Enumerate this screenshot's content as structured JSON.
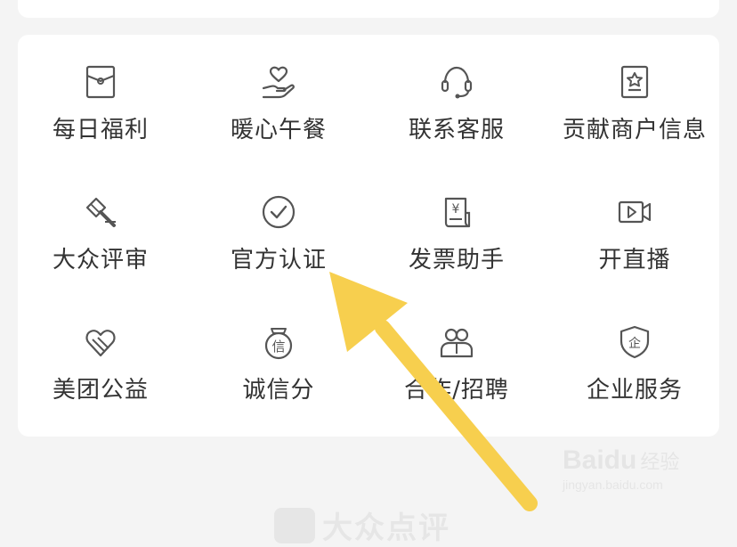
{
  "grid": {
    "items": [
      {
        "label": "每日福利",
        "icon": "envelope-icon"
      },
      {
        "label": "暖心午餐",
        "icon": "heart-hand-icon"
      },
      {
        "label": "联系客服",
        "icon": "headset-icon"
      },
      {
        "label": "贡献商户信息",
        "icon": "star-document-icon"
      },
      {
        "label": "大众评审",
        "icon": "gavel-icon"
      },
      {
        "label": "官方认证",
        "icon": "check-circle-icon"
      },
      {
        "label": "发票助手",
        "icon": "invoice-icon"
      },
      {
        "label": "开直播",
        "icon": "video-camera-icon"
      },
      {
        "label": "美团公益",
        "icon": "charity-heart-icon"
      },
      {
        "label": "诚信分",
        "icon": "credit-badge-icon"
      },
      {
        "label": "合作/招聘",
        "icon": "people-icon"
      },
      {
        "label": "企业服务",
        "icon": "shield-enterprise-icon"
      }
    ]
  },
  "icon_glyphs": {
    "invoice": "¥",
    "credit": "信",
    "enterprise": "企"
  },
  "footer": {
    "text": "大众点评"
  },
  "watermark": {
    "brand": "Baidu",
    "cn": "经验",
    "url": "jingyan.baidu.com"
  },
  "colors": {
    "arrow": "#f7cf4e",
    "icon": "#555555",
    "text": "#333333"
  }
}
